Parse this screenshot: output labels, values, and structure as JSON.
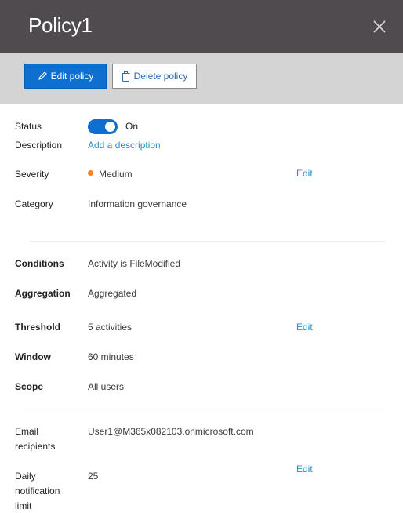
{
  "header": {
    "title": "Policy1",
    "close_icon": "close-icon"
  },
  "toolbar": {
    "edit_label": "Edit policy",
    "delete_label": "Delete policy",
    "edit_icon": "pencil-icon",
    "delete_icon": "trash-icon"
  },
  "colors": {
    "accent": "#0f6fd1",
    "link": "#2a8dbd",
    "severity_medium": "#f5811f",
    "header_bg": "#4f4b4f",
    "toolbar_bg": "#d4d4d4"
  },
  "details": {
    "status": {
      "label": "Status",
      "value": "On",
      "enabled": true
    },
    "description": {
      "label": "Description",
      "link": "Add a description"
    },
    "severity": {
      "label": "Severity",
      "value": "Medium",
      "edit": "Edit"
    },
    "category": {
      "label": "Category",
      "value": "Information governance"
    }
  },
  "conditions": {
    "conditions": {
      "label": "Conditions",
      "value": "Activity is FileModified"
    },
    "aggregation": {
      "label": "Aggregation",
      "value": "Aggregated"
    },
    "threshold": {
      "label": "Threshold",
      "value": "5 activities",
      "edit": "Edit"
    },
    "window": {
      "label": "Window",
      "value": "60 minutes"
    },
    "scope": {
      "label": "Scope",
      "value": "All users"
    }
  },
  "notifications": {
    "email": {
      "label_line1": "Email",
      "label_line2": "recipients",
      "value": "User1@M365x082103.onmicrosoft.com"
    },
    "daily_limit": {
      "label_line1": "Daily",
      "label_line2": "notification",
      "label_line3": "limit",
      "value": "25",
      "edit": "Edit"
    }
  }
}
